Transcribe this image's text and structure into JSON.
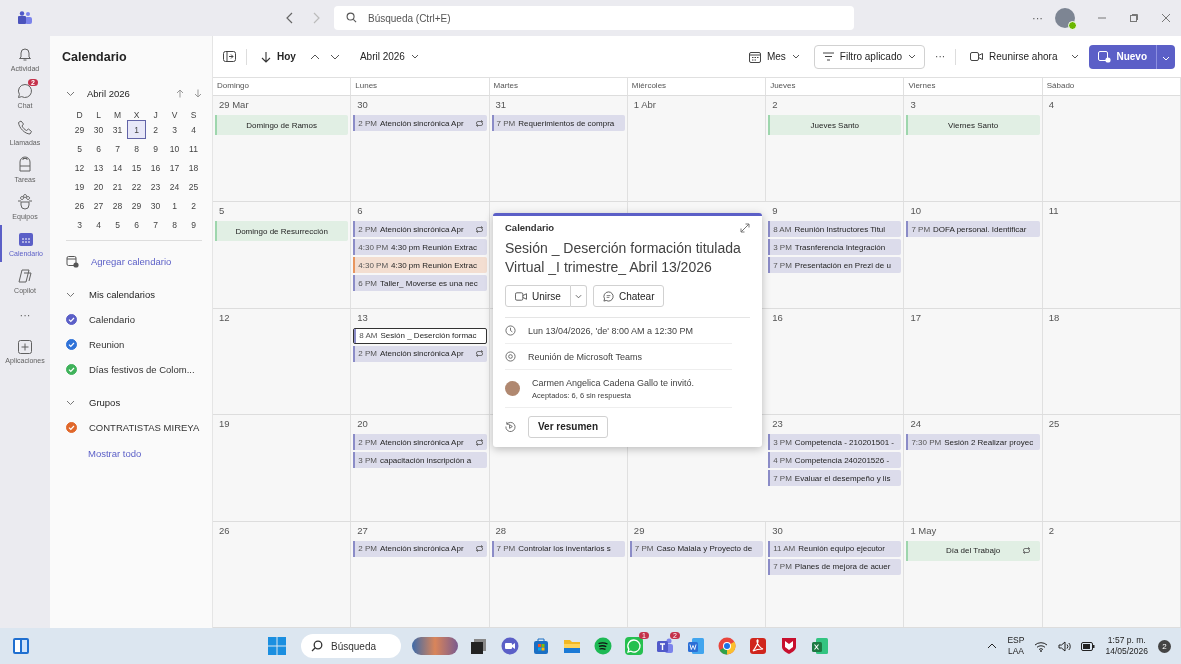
{
  "title_bar": {
    "search": {
      "placeholder": "Búsqueda (Ctrl+E)"
    },
    "more": "···"
  },
  "rail": {
    "items": [
      {
        "label": "Actividad",
        "selected": false
      },
      {
        "label": "Chat",
        "selected": false,
        "badge": "2"
      },
      {
        "label": "Llamadas",
        "selected": false
      },
      {
        "label": "Tareas",
        "selected": false
      },
      {
        "label": "Equipos",
        "selected": false
      },
      {
        "label": "Calendario",
        "selected": true
      },
      {
        "label": "Copilot",
        "selected": false
      }
    ],
    "more": "···",
    "apps": {
      "label": "Aplicaciones"
    }
  },
  "sidebar": {
    "title": "Calendario",
    "mini_calendar": {
      "month": "Abril 2026",
      "expanded": true,
      "weekdays": [
        "D",
        "L",
        "M",
        "X",
        "J",
        "V",
        "S"
      ],
      "weeks": [
        [
          {
            "d": "29",
            "selected": false
          },
          {
            "d": "30",
            "selected": false
          },
          {
            "d": "31",
            "selected": false
          },
          {
            "d": "1",
            "selected": true
          },
          {
            "d": "2",
            "selected": false
          },
          {
            "d": "3",
            "selected": false
          },
          {
            "d": "4",
            "selected": false
          }
        ],
        [
          {
            "d": "5",
            "selected": false
          },
          {
            "d": "6",
            "selected": false
          },
          {
            "d": "7",
            "selected": false
          },
          {
            "d": "8",
            "selected": false
          },
          {
            "d": "9",
            "selected": false
          },
          {
            "d": "10",
            "selected": false
          },
          {
            "d": "11",
            "selected": false
          }
        ],
        [
          {
            "d": "12",
            "selected": false
          },
          {
            "d": "13",
            "selected": false
          },
          {
            "d": "14",
            "selected": false
          },
          {
            "d": "15",
            "selected": false
          },
          {
            "d": "16",
            "selected": false
          },
          {
            "d": "17",
            "selected": false
          },
          {
            "d": "18",
            "selected": false
          }
        ],
        [
          {
            "d": "19",
            "selected": false
          },
          {
            "d": "20",
            "selected": false
          },
          {
            "d": "21",
            "selected": false
          },
          {
            "d": "22",
            "selected": false
          },
          {
            "d": "23",
            "selected": false
          },
          {
            "d": "24",
            "selected": false
          },
          {
            "d": "25",
            "selected": false
          }
        ],
        [
          {
            "d": "26",
            "selected": false
          },
          {
            "d": "27",
            "selected": false
          },
          {
            "d": "28",
            "selected": false
          },
          {
            "d": "29",
            "selected": false
          },
          {
            "d": "30",
            "selected": false
          },
          {
            "d": "1",
            "selected": false
          },
          {
            "d": "2",
            "selected": false
          }
        ],
        [
          {
            "d": "3",
            "selected": false
          },
          {
            "d": "4",
            "selected": false
          },
          {
            "d": "5",
            "selected": false
          },
          {
            "d": "6",
            "selected": false
          },
          {
            "d": "7",
            "selected": false
          },
          {
            "d": "8",
            "selected": false
          },
          {
            "d": "9",
            "selected": false
          }
        ]
      ]
    },
    "add_calendar": "Agregar calendario",
    "groups": [
      {
        "title": "Mis calendarios",
        "expanded": true,
        "items": [
          {
            "label": "Calendario",
            "checked": true,
            "color": "#5b5fc7"
          },
          {
            "label": "Reunion",
            "checked": true,
            "color": "#2f72d8"
          },
          {
            "label": "Días festivos de Colom...",
            "checked": true,
            "color": "#3fb25a"
          }
        ]
      },
      {
        "title": "Grupos",
        "expanded": true,
        "items": [
          {
            "label": "CONTRATISTAS MIREYA",
            "checked": true,
            "color": "#e0672a"
          }
        ]
      }
    ],
    "show_all": "Mostrar todo"
  },
  "toolbar": {
    "today": "Hoy",
    "month": "Abril 2026",
    "view": "Mes",
    "filter": "Filtro aplicado",
    "more": "···",
    "meet_now": "Reunirse ahora",
    "new": "Nuevo"
  },
  "calendar": {
    "weekdays": [
      "Domingo",
      "Lunes",
      "Martes",
      "Miércoles",
      "Jueves",
      "Viernes",
      "Sábado"
    ],
    "weeks": [
      {
        "days": [
          {
            "date": "29 Mar",
            "events": [
              {
                "kind": "holiday",
                "title": "Domingo de Ramos",
                "color": "#9ed6ad",
                "recurring": false,
                "selected": false
              }
            ]
          },
          {
            "date": "30",
            "events": [
              {
                "kind": "event",
                "time": "2 PM",
                "title": "Atención sincrónica Apr",
                "color": "#8b8cc7",
                "recurring": true,
                "selected": false
              }
            ]
          },
          {
            "date": "31",
            "events": [
              {
                "kind": "event",
                "time": "7 PM",
                "title": "Requerimientos de compra",
                "color": "#8b8cc7",
                "recurring": false,
                "selected": false
              }
            ]
          },
          {
            "date": "1 Abr"
          },
          {
            "date": "2",
            "events": [
              {
                "kind": "holiday",
                "title": "Jueves Santo",
                "color": "#9ed6ad",
                "recurring": false,
                "selected": false
              }
            ]
          },
          {
            "date": "3",
            "events": [
              {
                "kind": "holiday",
                "title": "Viernes Santo",
                "color": "#9ed6ad",
                "recurring": false,
                "selected": false
              }
            ]
          },
          {
            "date": "4"
          }
        ]
      },
      {
        "days": [
          {
            "date": "5",
            "events": [
              {
                "kind": "holiday",
                "title": "Domingo de Resurrección",
                "color": "#9ed6ad",
                "recurring": false,
                "selected": false
              }
            ]
          },
          {
            "date": "6",
            "events": [
              {
                "kind": "event",
                "time": "2 PM",
                "title": "Atención sincrónica Apr",
                "color": "#8b8cc7",
                "recurring": true,
                "selected": false
              },
              {
                "kind": "event",
                "time": "4:30 PM",
                "title": "4:30 pm Reunión Extrac",
                "color": "#8b8cc7",
                "recurring": false,
                "selected": false
              },
              {
                "kind": "event",
                "time": "4:30 PM",
                "title": "4:30 pm Reunión Extrac",
                "color": "#e8955e",
                "recurring": false,
                "selected": false
              },
              {
                "kind": "event",
                "time": "6 PM",
                "title": "Taller_ Moverse es una nec",
                "color": "#8b8cc7",
                "recurring": false,
                "selected": false
              }
            ]
          },
          {
            "date": "9",
            "events": [
              {
                "kind": "event",
                "time": "8 AM",
                "title": "Reunión Instructores Titul",
                "color": "#8b8cc7",
                "recurring": false,
                "selected": false
              },
              {
                "kind": "event",
                "time": "3 PM",
                "title": "Trasnferencia Integración",
                "color": "#8b8cc7",
                "recurring": false,
                "selected": false
              },
              {
                "kind": "event",
                "time": "7 PM",
                "title": "Presentación en Prezi de u",
                "color": "#8b8cc7",
                "recurring": false,
                "selected": false
              }
            ]
          },
          {
            "date": "10",
            "events": [
              {
                "kind": "event",
                "time": "7 PM",
                "title": "DOFA personal. Identificar",
                "color": "#8b8cc7",
                "recurring": false,
                "selected": false
              }
            ]
          },
          {
            "date": "11"
          }
        ]
      },
      {
        "days": [
          {
            "date": "12"
          },
          {
            "date": "13",
            "events": [
              {
                "kind": "event",
                "time": "8 AM",
                "title": "Sesión _ Deserción formac",
                "color": "#8b8cc7",
                "recurring": false,
                "selected": true
              },
              {
                "kind": "event",
                "time": "2 PM",
                "title": "Atención sincrónica Apr",
                "color": "#8b8cc7",
                "recurring": true,
                "selected": false
              }
            ]
          },
          {
            "date": "16"
          },
          {
            "date": "17"
          },
          {
            "date": "18"
          }
        ]
      },
      {
        "days": [
          {
            "date": "19"
          },
          {
            "date": "20",
            "events": [
              {
                "kind": "event",
                "time": "2 PM",
                "title": "Atención sincrónica Apr",
                "color": "#8b8cc7",
                "recurring": true,
                "selected": false
              },
              {
                "kind": "event",
                "time": "3 PM",
                "title": "capacitación inscripción a",
                "color": "#8b8cc7",
                "recurring": false,
                "selected": false
              }
            ]
          },
          {
            "date": "23",
            "events": [
              {
                "kind": "event",
                "time": "3 PM",
                "title": "Competencia - 210201501 -",
                "color": "#8b8cc7",
                "recurring": false,
                "selected": false
              },
              {
                "kind": "event",
                "time": "4 PM",
                "title": "Competencia 240201526 -",
                "color": "#8b8cc7",
                "recurring": false,
                "selected": false
              },
              {
                "kind": "event",
                "time": "7 PM",
                "title": "Evaluar el desempeño y lis",
                "color": "#8b8cc7",
                "recurring": false,
                "selected": false
              }
            ]
          },
          {
            "date": "24",
            "events": [
              {
                "kind": "event",
                "time": "7:30 PM",
                "title": "Sesión 2 Realizar proyec",
                "color": "#8b8cc7",
                "recurring": false,
                "selected": false
              }
            ]
          },
          {
            "date": "25"
          }
        ]
      },
      {
        "days": [
          {
            "date": "26"
          },
          {
            "date": "27",
            "events": [
              {
                "kind": "event",
                "time": "2 PM",
                "title": "Atención sincrónica Apr",
                "color": "#8b8cc7",
                "recurring": true,
                "selected": false
              }
            ]
          },
          {
            "date": "28",
            "events": [
              {
                "kind": "event",
                "time": "7 PM",
                "title": "Controlar los inventarios s",
                "color": "#8b8cc7",
                "recurring": false,
                "selected": false
              }
            ]
          },
          {
            "date": "29",
            "events": [
              {
                "kind": "event",
                "time": "7 PM",
                "title": "Caso Malala y Proyecto de",
                "color": "#8b8cc7",
                "recurring": false,
                "selected": false
              }
            ]
          },
          {
            "date": "30",
            "events": [
              {
                "kind": "event",
                "time": "11 AM",
                "title": "Reunión equipo ejecutor",
                "color": "#8b8cc7",
                "recurring": false,
                "selected": false
              },
              {
                "kind": "event",
                "time": "7 PM",
                "title": "Planes de mejora de acuer",
                "color": "#8b8cc7",
                "recurring": false,
                "selected": false
              }
            ]
          },
          {
            "date": "1 May",
            "events": [
              {
                "kind": "holiday",
                "title": "Día del Trabajo",
                "color": "#9ed6ad",
                "recurring": true,
                "selected": false
              }
            ]
          },
          {
            "date": "2"
          }
        ]
      }
    ]
  },
  "popup": {
    "calendar": "Calendario",
    "title": "Sesión _ Deserción formación titulada Virtual _I trimestre_ Abril 13/2026",
    "join": "Unirse",
    "chat": "Chatear",
    "when": "Lun 13/04/2026, 'de' 8:00 AM a 12:30 PM",
    "where": "Reunión de Microsoft Teams",
    "organizer": "Carmen Angelica Cadena Gallo te invitó.",
    "responses": "Aceptados: 6, 6 sin respuesta",
    "recap": "Ver resumen"
  },
  "taskbar": {
    "search": {
      "placeholder": "Búsqueda"
    },
    "apps": [
      {
        "kind": "taskview"
      },
      {
        "kind": "meet"
      },
      {
        "kind": "store"
      },
      {
        "kind": "folder"
      },
      {
        "kind": "music"
      },
      {
        "kind": "whatsapp",
        "badge": "1"
      },
      {
        "kind": "teams",
        "badge": "2"
      },
      {
        "kind": "word"
      },
      {
        "kind": "chrome"
      },
      {
        "kind": "pdf"
      },
      {
        "kind": "shield"
      },
      {
        "kind": "excel"
      }
    ],
    "language": "ESP",
    "layout": "LAA",
    "time": "1:57 p. m.",
    "date": "14/05/2026",
    "notifications": "2"
  }
}
